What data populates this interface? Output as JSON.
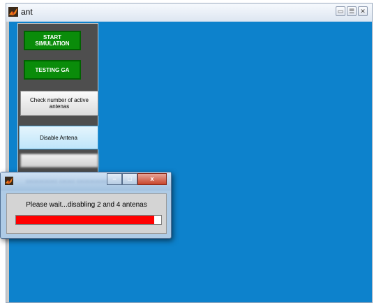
{
  "window": {
    "title": "ant",
    "subtitle_blurred": "",
    "controls": [
      "minimize",
      "maximize",
      "close"
    ]
  },
  "panel": {
    "start_simulation_label": "START SIMULATION",
    "testing_ga_label": "TESTING GA",
    "check_active_label": "Check number of active antenas",
    "disable_antena_label": "Disable Antena"
  },
  "dialog": {
    "message": "Please wait...disabling 2 and 4 antenas",
    "progress_fraction": 0.95,
    "close_glyph": "x",
    "minimize_glyph": "–",
    "maximize_glyph": "□"
  },
  "colors": {
    "content_background": "#0d82cc",
    "panel_background": "#4e4e4e",
    "green_button": "#0a8c0a",
    "progress_fill": "#ff0000"
  },
  "icons": {
    "app": "matlab-icon",
    "dialog": "matlab-icon"
  }
}
